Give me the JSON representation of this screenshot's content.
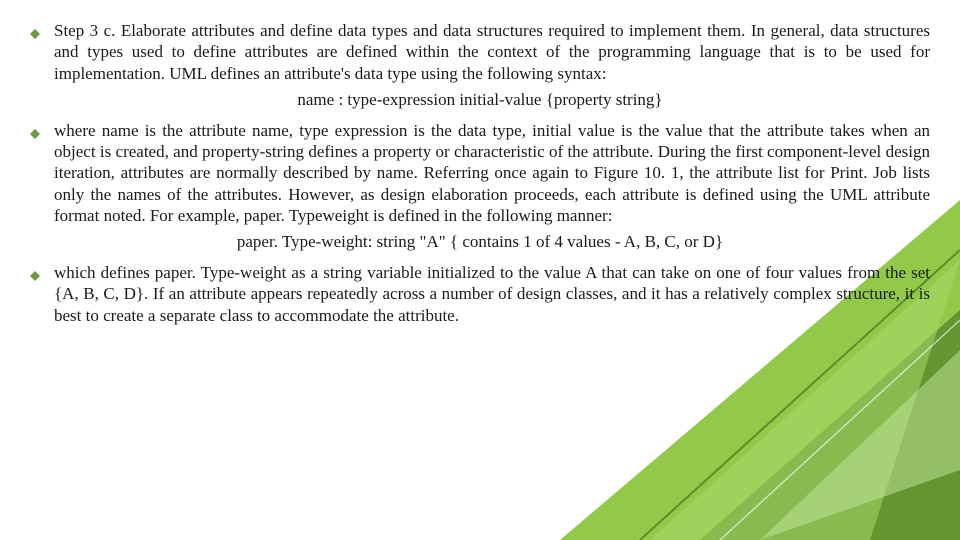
{
  "bullets": [
    {
      "text": "Step 3 c. Elaborate attributes and define data types and data structures required to implement them. In general, data structures and types used to define attributes are defined within the context of the programming language that is to be used for implementation. UML defines an attribute's data type using the following syntax:"
    },
    {
      "text": "where name is the attribute name, type expression is the data type, initial value is the value that the attribute takes when an object is created, and property-string defines a property or characteristic of the attribute. During the first component-level design iteration, attributes are normally described by name. Referring once again to Figure 10. 1, the attribute list for Print. Job lists only the names of the attributes. However, as design elaboration proceeds, each attribute is defined using the UML attribute format noted. For example, paper. Typeweight is defined in the following manner:"
    },
    {
      "text": "which defines paper. Type-weight as a string variable initialized to the value A that can take on one of four values from the set {A, B, C, D}. If an attribute appears repeatedly across a number of design classes, and it has a relatively complex structure, it is best to create a separate class to accommodate the attribute."
    }
  ],
  "lines": [
    "name : type-expression  initial-value {property string}",
    "paper. Type-weight: string  \"A\" { contains 1 of 4 values - A, B, C, or D}"
  ]
}
